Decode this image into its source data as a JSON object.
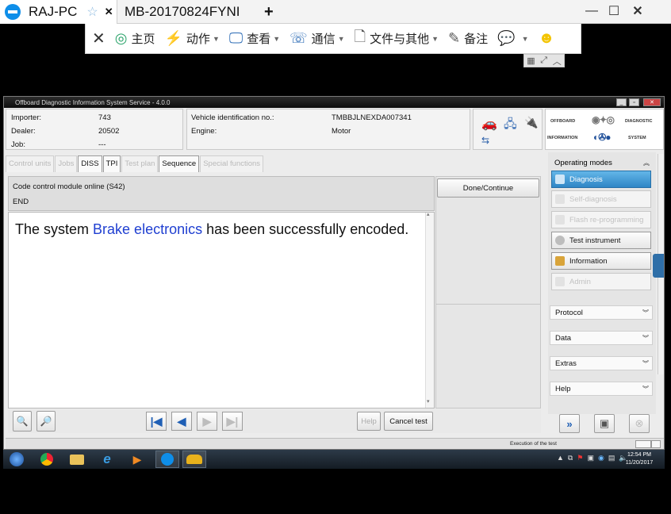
{
  "teamviewer": {
    "tabs": [
      {
        "label": "RAJ-PC",
        "star": "☆",
        "close": "✕"
      },
      {
        "label": "MB-20170824FYNI"
      }
    ],
    "add_tab": "+",
    "window_controls": [
      "—",
      "☐",
      "✕"
    ],
    "toolbar": {
      "close": "✕",
      "home": "主页",
      "actions": "动作",
      "view": "查看",
      "communicate": "通信",
      "files": "文件与其他",
      "notes": "备注"
    }
  },
  "app": {
    "title": "Offboard Diagnostic Information System Service - 4.0.0",
    "vehicle": {
      "importer_label": "Importer:",
      "importer": "743",
      "dealer_label": "Dealer:",
      "dealer": "20502",
      "job_label": "Job:",
      "job": "---",
      "vin_label": "Vehicle identification no.:",
      "vin": "TMBBJLNEXDA007341",
      "engine_label": "Engine:",
      "engine": "Motor"
    },
    "logo": {
      "left_top": "OFFBOARD",
      "left_bottom": "INFORMATION",
      "right_top": "DIAGNOSTIC",
      "right_bottom": "SYSTEM"
    },
    "tabs": [
      "Control units",
      "Jobs",
      "DISS",
      "TPI",
      "Test plan",
      "Sequence",
      "Special functions"
    ],
    "message": {
      "code_line": "Code control module online (S42)",
      "end_line": "END",
      "text_prefix": "The system ",
      "text_highlight": "Brake electronics",
      "text_suffix": " has been successfully encoded."
    },
    "done_button": "Done/Continue",
    "help_button": "Help",
    "cancel_button": "Cancel test",
    "operating_modes": {
      "header": "Operating modes",
      "items": [
        {
          "label": "Diagnosis",
          "state": "selected"
        },
        {
          "label": "Self-diagnosis",
          "state": "disabled"
        },
        {
          "label": "Flash re-programming",
          "state": "disabled"
        },
        {
          "label": "Test instrument",
          "state": "enabled"
        },
        {
          "label": "Information",
          "state": "enabled"
        },
        {
          "label": "Admin",
          "state": "disabled"
        }
      ]
    },
    "sections": [
      "Protocol",
      "Data",
      "Extras",
      "Help"
    ],
    "status_text": "Execution of the test"
  },
  "taskbar": {
    "time": "12:54 PM",
    "date": "11/20/2017"
  },
  "colors": {
    "highlight_text": "#1f3fd1",
    "selected_mode": "#2f86c6",
    "teamviewer_blue": "#0e8ee9"
  }
}
